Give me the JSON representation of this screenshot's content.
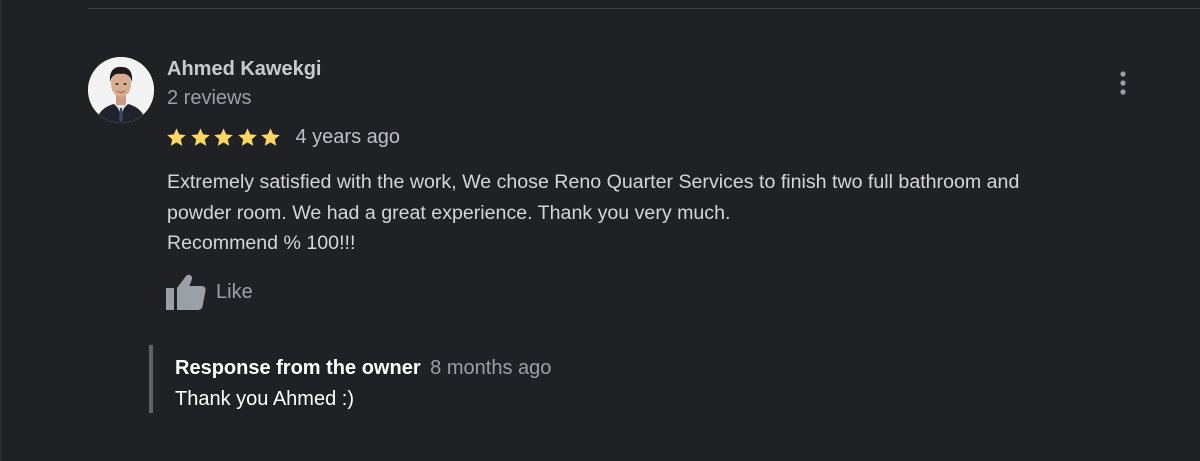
{
  "review": {
    "author_name": "Ahmed Kawekgi",
    "author_review_count": "2 reviews",
    "rating": 5,
    "rating_max": 5,
    "time_ago": "4 years ago",
    "text_lines": [
      "Extremely satisfied with the work, We chose Reno Quarter Services to finish two full bathroom and",
      "powder room. We had a great experience. Thank you very much.",
      "Recommend % 100!!!"
    ],
    "like_label": "Like",
    "star_color": "#fdd663",
    "menu_icon": "more-vert-icon"
  },
  "owner_response": {
    "label": "Response from the owner",
    "time_ago": "8 months ago",
    "text": "Thank you Ahmed :)"
  },
  "colors": {
    "background": "#202124",
    "primary_text": "#e8eaed",
    "secondary_text": "#9aa0a6"
  }
}
